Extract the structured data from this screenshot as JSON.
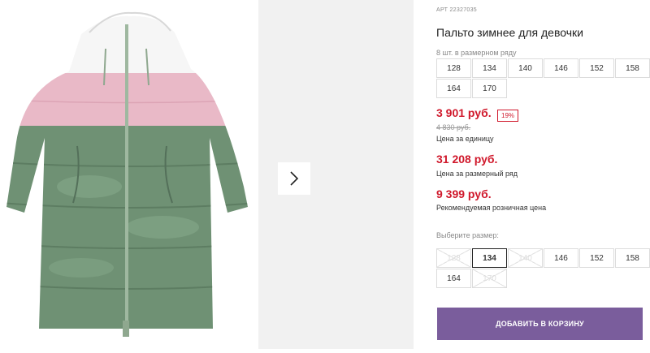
{
  "product": {
    "article": "АРТ 22327035",
    "title": "Пальто зимнее для девочки"
  },
  "pack": {
    "label": "8 шт. в размерном ряду",
    "sizes": [
      "128",
      "134",
      "140",
      "146",
      "152",
      "158",
      "164",
      "170"
    ]
  },
  "pricing": {
    "unit_price": "3 901 руб.",
    "discount": "19%",
    "old_price": "4 830 руб.",
    "unit_caption": "Цена за единицу",
    "pack_price": "31 208 руб.",
    "pack_caption": "Цена за размерный ряд",
    "retail_price": "9 399 руб.",
    "retail_caption": "Рекомендуемая розничная цена"
  },
  "size_select": {
    "label": "Выберите размер:",
    "sizes": [
      {
        "label": "128",
        "state": "disabled"
      },
      {
        "label": "134",
        "state": "selected"
      },
      {
        "label": "140",
        "state": "disabled"
      },
      {
        "label": "146",
        "state": "available"
      },
      {
        "label": "152",
        "state": "available"
      },
      {
        "label": "158",
        "state": "available"
      },
      {
        "label": "164",
        "state": "available"
      },
      {
        "label": "170",
        "state": "disabled"
      }
    ]
  },
  "cart_button": "ДОБАВИТЬ В КОРЗИНУ",
  "icons": {
    "next": "chevron-right-icon"
  },
  "colors": {
    "price_red": "#d0182b",
    "cart_purple": "#7a5d9c",
    "coat_green": "#6e8f72",
    "coat_pink": "#e7b4c4"
  }
}
